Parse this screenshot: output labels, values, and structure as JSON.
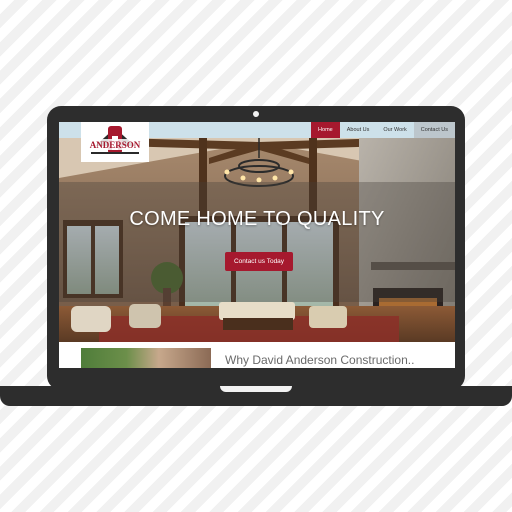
{
  "nav": {
    "logo_text": "ANDERSON",
    "links": [
      "Home",
      "About Us",
      "Our Work",
      "Contact Us"
    ]
  },
  "hero": {
    "title": "COME HOME TO QUALITY",
    "cta": "Contact us Today"
  },
  "section": {
    "title": "Why David Anderson Construction.."
  },
  "colors": {
    "accent": "#a6192e",
    "nav_bg": "#cde1ea",
    "device": "#2d2d2d"
  }
}
